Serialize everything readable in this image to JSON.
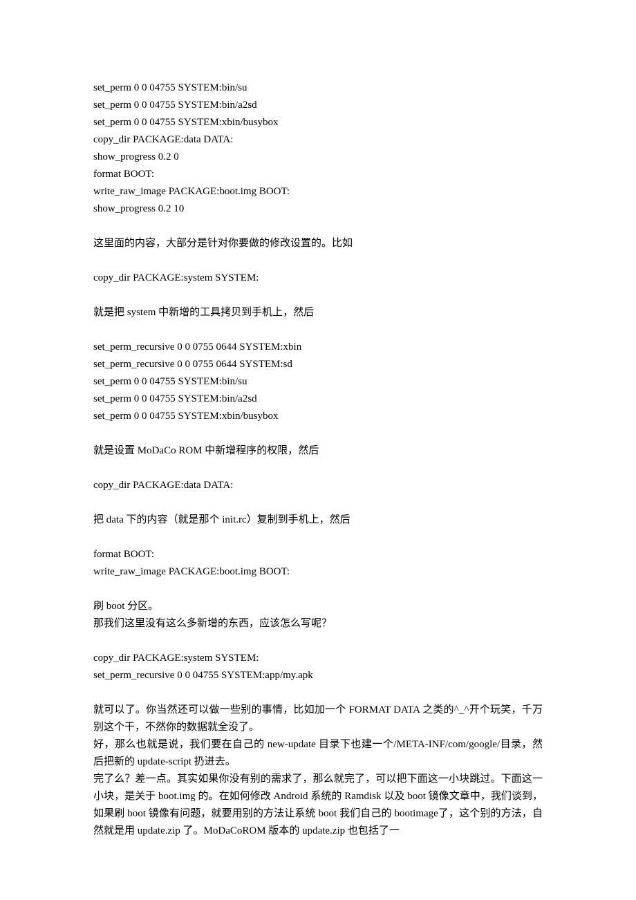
{
  "lines": [
    "set_perm 0 0 04755 SYSTEM:bin/su",
    "set_perm 0 0 04755 SYSTEM:bin/a2sd",
    "set_perm 0 0 04755 SYSTEM:xbin/busybox",
    "copy_dir PACKAGE:data DATA:",
    "show_progress 0.2 0",
    "format BOOT:",
    "write_raw_image PACKAGE:boot.img BOOT:",
    "show_progress 0.2 10",
    "",
    "这里面的内容，大部分是针对你要做的修改设置的。比如",
    "",
    "copy_dir PACKAGE:system SYSTEM:",
    "",
    "就是把 system 中新增的工具拷贝到手机上，然后",
    "",
    "set_perm_recursive 0 0 0755 0644 SYSTEM:xbin",
    "set_perm_recursive 0 0 0755 0644 SYSTEM:sd",
    "set_perm 0 0 04755 SYSTEM:bin/su",
    "set_perm 0 0 04755 SYSTEM:bin/a2sd",
    "set_perm 0 0 04755 SYSTEM:xbin/busybox",
    "",
    "就是设置 MoDaCo ROM 中新增程序的权限，然后",
    "",
    "copy_dir PACKAGE:data DATA:",
    "",
    "把 data 下的内容（就是那个 init.rc）复制到手机上，然后",
    "",
    "format BOOT:",
    "write_raw_image PACKAGE:boot.img BOOT:",
    "",
    "刷 boot 分区。",
    "那我们这里没有这么多新增的东西，应该怎么写呢？",
    "",
    "copy_dir PACKAGE:system SYSTEM:",
    "set_perm_recursive 0 0 04755 SYSTEM:app/my.apk",
    "",
    "就可以了。你当然还可以做一些别的事情，比如加一个 FORMAT DATA 之类的^_^开个玩笑，千万别这个干，不然你的数据就全没了。",
    "好，那么也就是说，我们要在自己的 new-update 目录下也建一个/META-INF/com/google/目录，然后把新的 update-script 扔进去。",
    "完了么？差一点。其实如果你没有别的需求了，那么就完了，可以把下面这一小块跳过。下面这一小块，是关于 boot.img 的。在如何修改 Android 系统的 Ramdisk 以及 boot 镜像文章中，我们谈到，如果刷 boot 镜像有问题，就要用别的方法让系统 boot 我们自己的 bootimage了，这个别的方法，自然就是用 update.zip 了。MoDaCoROM 版本的 update.zip 也包括了一"
  ]
}
